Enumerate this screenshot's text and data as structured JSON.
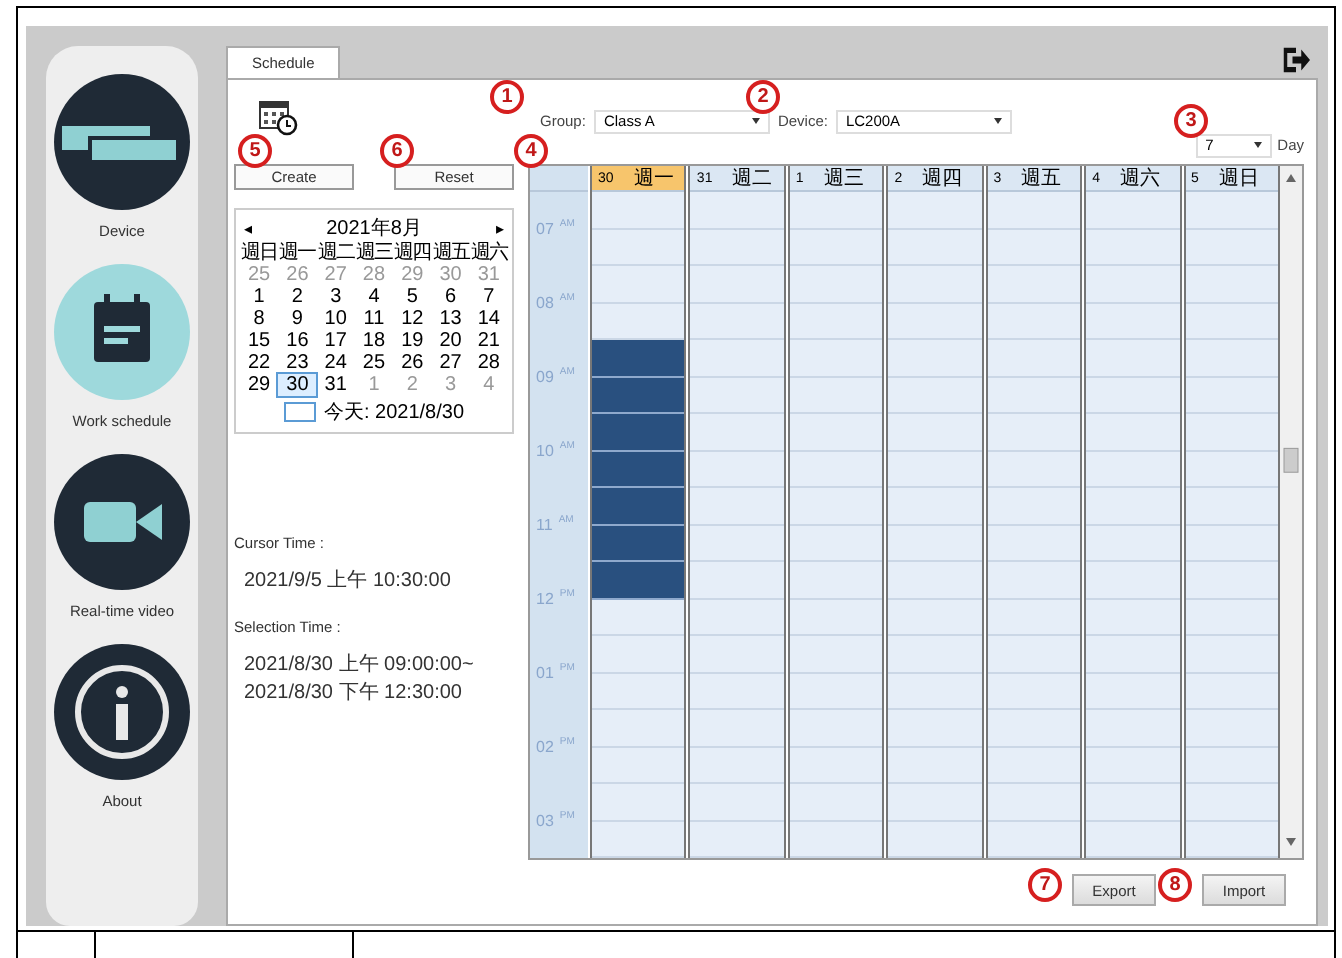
{
  "sidebar": {
    "items": [
      {
        "kind": "device",
        "label": "Device",
        "selected": false
      },
      {
        "kind": "schedule",
        "label": "Work schedule",
        "selected": true
      },
      {
        "kind": "video",
        "label": "Real-time video",
        "selected": false
      },
      {
        "kind": "info",
        "label": "About",
        "selected": false
      }
    ]
  },
  "tabs": [
    {
      "label": "Schedule",
      "selected": true
    }
  ],
  "buttons": {
    "create": "Create",
    "reset": "Reset",
    "export": "Export",
    "import": "Import"
  },
  "mini_calendar": {
    "prev": "◂",
    "title": "2021年8月",
    "next": "▸",
    "weekdays": [
      "週日",
      "週一",
      "週二",
      "週三",
      "週四",
      "週五",
      "週六"
    ],
    "weeks": [
      [
        {
          "d": "25",
          "muted": true,
          "selected": false
        },
        {
          "d": "26",
          "muted": true,
          "selected": false
        },
        {
          "d": "27",
          "muted": true,
          "selected": false
        },
        {
          "d": "28",
          "muted": true,
          "selected": false
        },
        {
          "d": "29",
          "muted": true,
          "selected": false
        },
        {
          "d": "30",
          "muted": true,
          "selected": false
        },
        {
          "d": "31",
          "muted": true,
          "selected": false
        }
      ],
      [
        {
          "d": "1",
          "muted": false,
          "selected": false
        },
        {
          "d": "2",
          "muted": false,
          "selected": false
        },
        {
          "d": "3",
          "muted": false,
          "selected": false
        },
        {
          "d": "4",
          "muted": false,
          "selected": false
        },
        {
          "d": "5",
          "muted": false,
          "selected": false
        },
        {
          "d": "6",
          "muted": false,
          "selected": false
        },
        {
          "d": "7",
          "muted": false,
          "selected": false
        }
      ],
      [
        {
          "d": "8",
          "muted": false,
          "selected": false
        },
        {
          "d": "9",
          "muted": false,
          "selected": false
        },
        {
          "d": "10",
          "muted": false,
          "selected": false
        },
        {
          "d": "11",
          "muted": false,
          "selected": false
        },
        {
          "d": "12",
          "muted": false,
          "selected": false
        },
        {
          "d": "13",
          "muted": false,
          "selected": false
        },
        {
          "d": "14",
          "muted": false,
          "selected": false
        }
      ],
      [
        {
          "d": "15",
          "muted": false,
          "selected": false
        },
        {
          "d": "16",
          "muted": false,
          "selected": false
        },
        {
          "d": "17",
          "muted": false,
          "selected": false
        },
        {
          "d": "18",
          "muted": false,
          "selected": false
        },
        {
          "d": "19",
          "muted": false,
          "selected": false
        },
        {
          "d": "20",
          "muted": false,
          "selected": false
        },
        {
          "d": "21",
          "muted": false,
          "selected": false
        }
      ],
      [
        {
          "d": "22",
          "muted": false,
          "selected": false
        },
        {
          "d": "23",
          "muted": false,
          "selected": false
        },
        {
          "d": "24",
          "muted": false,
          "selected": false
        },
        {
          "d": "25",
          "muted": false,
          "selected": false
        },
        {
          "d": "26",
          "muted": false,
          "selected": false
        },
        {
          "d": "27",
          "muted": false,
          "selected": false
        },
        {
          "d": "28",
          "muted": false,
          "selected": false
        }
      ],
      [
        {
          "d": "29",
          "muted": false,
          "selected": false
        },
        {
          "d": "30",
          "muted": false,
          "selected": true
        },
        {
          "d": "31",
          "muted": false,
          "selected": false
        },
        {
          "d": "1",
          "muted": true,
          "selected": false
        },
        {
          "d": "2",
          "muted": true,
          "selected": false
        },
        {
          "d": "3",
          "muted": true,
          "selected": false
        },
        {
          "d": "4",
          "muted": true,
          "selected": false
        }
      ]
    ],
    "today": "今天: 2021/8/30"
  },
  "cursor_time": {
    "label": "Cursor Time :",
    "value": "2021/9/5 上午 10:30:00"
  },
  "selection_time": {
    "label": "Selection Time :",
    "lines": [
      "2021/8/30 上午 09:00:00~",
      "2021/8/30 下午 12:30:00"
    ]
  },
  "filters": {
    "group_label": "Group:",
    "group_value": "Class A",
    "device_label": "Device:",
    "device_value": "LC200A",
    "days_value": "7",
    "days_label": "Day"
  },
  "schedule": {
    "hours": [
      {
        "hour": "07",
        "period": "AM"
      },
      {
        "hour": "08",
        "period": "AM"
      },
      {
        "hour": "09",
        "period": "AM"
      },
      {
        "hour": "10",
        "period": "AM"
      },
      {
        "hour": "11",
        "period": "AM"
      },
      {
        "hour": "12",
        "period": "PM"
      },
      {
        "hour": "01",
        "period": "PM"
      },
      {
        "hour": "02",
        "period": "PM"
      },
      {
        "hour": "03",
        "period": "PM"
      }
    ],
    "days": [
      {
        "date": "30",
        "weekday": "週一",
        "selected": true,
        "slots": [
          {
            "selected": false
          },
          {
            "selected": false
          },
          {
            "selected": false
          },
          {
            "selected": false
          },
          {
            "selected": true
          },
          {
            "selected": true
          },
          {
            "selected": true
          },
          {
            "selected": true
          },
          {
            "selected": true
          },
          {
            "selected": true
          },
          {
            "selected": true
          },
          {
            "selected": false
          },
          {
            "selected": false
          },
          {
            "selected": false
          },
          {
            "selected": false
          },
          {
            "selected": false
          },
          {
            "selected": false
          },
          {
            "selected": false
          }
        ]
      },
      {
        "date": "31",
        "weekday": "週二",
        "selected": false,
        "slots": [
          {
            "selected": false
          },
          {
            "selected": false
          },
          {
            "selected": false
          },
          {
            "selected": false
          },
          {
            "selected": false
          },
          {
            "selected": false
          },
          {
            "selected": false
          },
          {
            "selected": false
          },
          {
            "selected": false
          },
          {
            "selected": false
          },
          {
            "selected": false
          },
          {
            "selected": false
          },
          {
            "selected": false
          },
          {
            "selected": false
          },
          {
            "selected": false
          },
          {
            "selected": false
          },
          {
            "selected": false
          },
          {
            "selected": false
          }
        ]
      },
      {
        "date": "1",
        "weekday": "週三",
        "selected": false,
        "slots": [
          {
            "selected": false
          },
          {
            "selected": false
          },
          {
            "selected": false
          },
          {
            "selected": false
          },
          {
            "selected": false
          },
          {
            "selected": false
          },
          {
            "selected": false
          },
          {
            "selected": false
          },
          {
            "selected": false
          },
          {
            "selected": false
          },
          {
            "selected": false
          },
          {
            "selected": false
          },
          {
            "selected": false
          },
          {
            "selected": false
          },
          {
            "selected": false
          },
          {
            "selected": false
          },
          {
            "selected": false
          },
          {
            "selected": false
          }
        ]
      },
      {
        "date": "2",
        "weekday": "週四",
        "selected": false,
        "slots": [
          {
            "selected": false
          },
          {
            "selected": false
          },
          {
            "selected": false
          },
          {
            "selected": false
          },
          {
            "selected": false
          },
          {
            "selected": false
          },
          {
            "selected": false
          },
          {
            "selected": false
          },
          {
            "selected": false
          },
          {
            "selected": false
          },
          {
            "selected": false
          },
          {
            "selected": false
          },
          {
            "selected": false
          },
          {
            "selected": false
          },
          {
            "selected": false
          },
          {
            "selected": false
          },
          {
            "selected": false
          },
          {
            "selected": false
          }
        ]
      },
      {
        "date": "3",
        "weekday": "週五",
        "selected": false,
        "slots": [
          {
            "selected": false
          },
          {
            "selected": false
          },
          {
            "selected": false
          },
          {
            "selected": false
          },
          {
            "selected": false
          },
          {
            "selected": false
          },
          {
            "selected": false
          },
          {
            "selected": false
          },
          {
            "selected": false
          },
          {
            "selected": false
          },
          {
            "selected": false
          },
          {
            "selected": false
          },
          {
            "selected": false
          },
          {
            "selected": false
          },
          {
            "selected": false
          },
          {
            "selected": false
          },
          {
            "selected": false
          },
          {
            "selected": false
          }
        ]
      },
      {
        "date": "4",
        "weekday": "週六",
        "selected": false,
        "slots": [
          {
            "selected": false
          },
          {
            "selected": false
          },
          {
            "selected": false
          },
          {
            "selected": false
          },
          {
            "selected": false
          },
          {
            "selected": false
          },
          {
            "selected": false
          },
          {
            "selected": false
          },
          {
            "selected": false
          },
          {
            "selected": false
          },
          {
            "selected": false
          },
          {
            "selected": false
          },
          {
            "selected": false
          },
          {
            "selected": false
          },
          {
            "selected": false
          },
          {
            "selected": false
          },
          {
            "selected": false
          },
          {
            "selected": false
          }
        ]
      },
      {
        "date": "5",
        "weekday": "週日",
        "selected": false,
        "slots": [
          {
            "selected": false
          },
          {
            "selected": false
          },
          {
            "selected": false
          },
          {
            "selected": false
          },
          {
            "selected": false
          },
          {
            "selected": false
          },
          {
            "selected": false
          },
          {
            "selected": false
          },
          {
            "selected": false
          },
          {
            "selected": false
          },
          {
            "selected": false
          },
          {
            "selected": false
          },
          {
            "selected": false
          },
          {
            "selected": false
          },
          {
            "selected": false
          },
          {
            "selected": false
          },
          {
            "selected": false
          },
          {
            "selected": false
          }
        ]
      }
    ]
  },
  "callouts": [
    "1",
    "2",
    "3",
    "5",
    "6",
    "4",
    "7",
    "8"
  ]
}
